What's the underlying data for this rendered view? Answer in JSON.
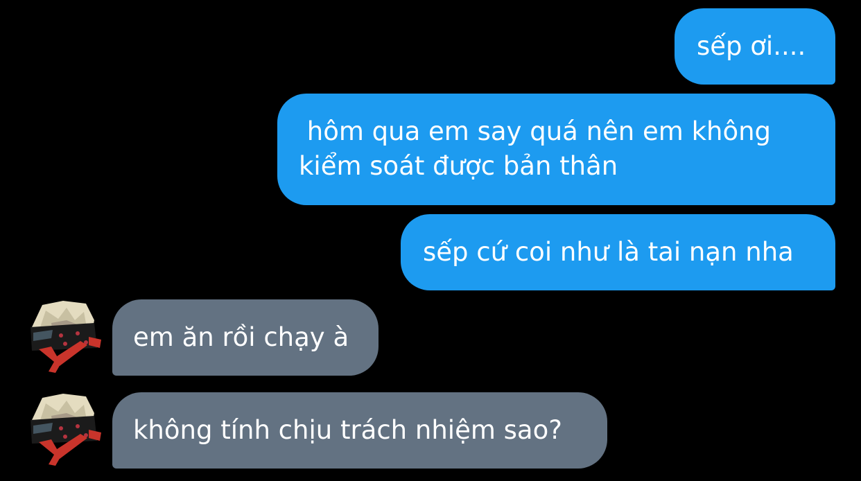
{
  "chat": {
    "theme_colors": {
      "background": "#000000",
      "sent_bubble": "#1d9bf0",
      "received_bubble": "#637282",
      "text": "#ffffff"
    },
    "messages": [
      {
        "direction": "sent",
        "text": "sếp ơi...."
      },
      {
        "direction": "sent",
        "text": " hôm qua em say quá nên em không\nkiểm soát được bản thân"
      },
      {
        "direction": "sent",
        "text": "sếp cứ coi như là tai nạn nha"
      },
      {
        "direction": "received",
        "text": "em ăn rồi chạy à",
        "avatar": "contact-avatar"
      },
      {
        "direction": "received",
        "text": "không tính chịu trách nhiệm sao?",
        "avatar": "contact-avatar"
      }
    ]
  }
}
